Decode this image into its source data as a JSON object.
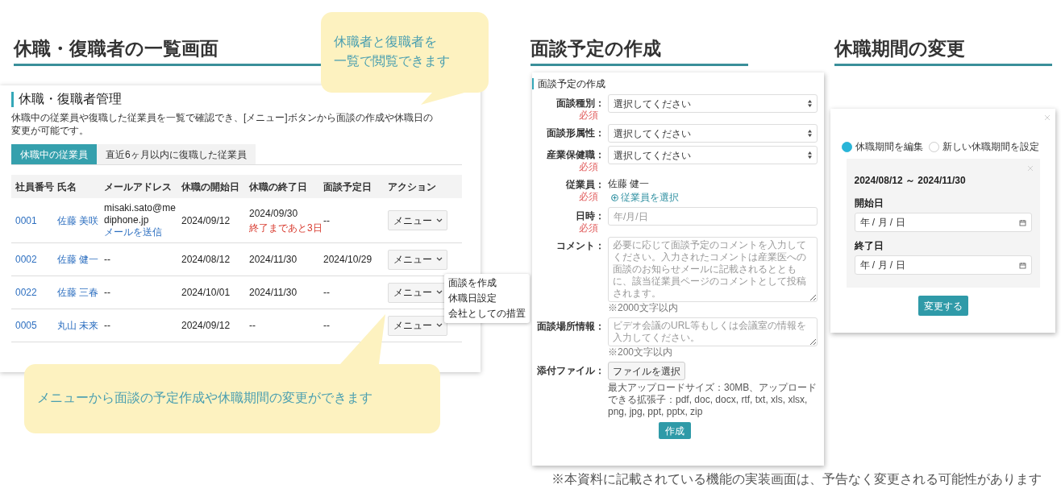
{
  "headings": [
    {
      "text": "休職・復職者の一覧画面"
    },
    {
      "text": "面談予定の作成"
    },
    {
      "text": "休職期間の変更"
    }
  ],
  "list_screen": {
    "title": "休職・復職者管理",
    "description": "休職中の従業員や復職した従業員を一覧で確認でき、[メニュー]ボタンから面談の作成や休職日の変更が可能です。",
    "tabs": [
      {
        "label": "休職中の従業員",
        "selected": true
      },
      {
        "label": "直近6ヶ月以内に復職した従業員",
        "selected": false
      }
    ],
    "columns": [
      "社員番号",
      "氏名",
      "メールアドレス",
      "休職の開始日",
      "休職の終了日",
      "面談予定日",
      "アクション"
    ],
    "rows": [
      {
        "id": "0001",
        "name": "佐藤 美咲",
        "email": "misaki.sato@mediphone.jp",
        "email_link": "メールを送信",
        "start": "2024/09/12",
        "end": "2024/09/30",
        "end_note": "終了まであと3日",
        "interview": "--",
        "action": "メニュー"
      },
      {
        "id": "0002",
        "name": "佐藤 健一",
        "email": "--",
        "start": "2024/08/12",
        "end": "2024/11/30",
        "interview": "2024/10/29",
        "action": "メニュー"
      },
      {
        "id": "0022",
        "name": "佐藤 三春",
        "email": "--",
        "start": "2024/10/01",
        "end": "2024/11/30",
        "interview": "--",
        "action": "メニュー"
      },
      {
        "id": "0005",
        "name": "丸山 未来",
        "email": "--",
        "start": "2024/09/12",
        "end": "--",
        "interview": "--",
        "action": "メニュー"
      }
    ],
    "menu": {
      "items": [
        "面談を作成",
        "休職日設定",
        "会社としての措置"
      ]
    }
  },
  "callouts": [
    {
      "lines": [
        "休職者と復職者を",
        "一覧で閲覧できます"
      ]
    },
    {
      "lines": [
        "メニューから面談の予定作成や休職期間の変更ができます"
      ]
    }
  ],
  "interview_form": {
    "title": "面談予定の作成",
    "fields": [
      {
        "kind": "select",
        "label": "面談種別：",
        "required": "必須",
        "placeholder": "選択してください"
      },
      {
        "kind": "select",
        "label": "面談形属性：",
        "placeholder": "選択してください"
      },
      {
        "kind": "select",
        "label": "産業保健職：",
        "required": "必須",
        "placeholder": "選択してください"
      },
      {
        "kind": "employee",
        "label": "従業員：",
        "required": "必須",
        "value": "佐藤 健一",
        "link": "従業員を選択"
      },
      {
        "kind": "date",
        "label": "日時：",
        "required": "必須",
        "placeholder": "年/月/日"
      },
      {
        "kind": "textarea",
        "label": "コメント：",
        "placeholder": "必要に応じて面談予定のコメントを入力してください。入力されたコメントは産業医への面談のお知らせメールに記載されるとともに、該当従業員ページのコメントとして投稿されます。",
        "note": "※2000文字以内"
      },
      {
        "kind": "textarea",
        "label": "面談場所情報：",
        "placeholder": "ビデオ会議のURL等もしくは会議室の情報を入力してください。",
        "note": "※200文字以内"
      },
      {
        "kind": "file",
        "label": "添付ファイル：",
        "button": "ファイルを選択",
        "note": "最大アップロードサイズ：30MB、アップロードできる拡張子：pdf, doc, docx, rtf, txt, xls, xlsx, png, jpg, ppt, pptx, zip"
      }
    ],
    "submit": "作成"
  },
  "period_change": {
    "options": [
      {
        "label": "休職期間を編集",
        "selected": true
      },
      {
        "label": "新しい休職期間を設定",
        "selected": false
      }
    ],
    "range": "2024/08/12 ～ 2024/11/30",
    "fields": [
      {
        "label": "開始日",
        "placeholder": "年 / 月 / 日"
      },
      {
        "label": "終了日",
        "placeholder": "年 / 月 / 日"
      }
    ],
    "submit": "変更する"
  },
  "footnote": "※本資料に記載されている機能の実装画面は、予告なく変更される可能性があります"
}
